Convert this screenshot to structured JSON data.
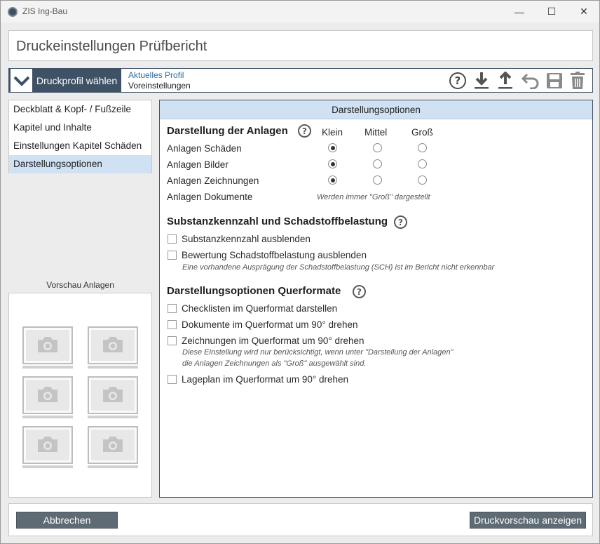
{
  "window": {
    "title": "ZIS Ing-Bau",
    "controls": {
      "minimize": "—",
      "maximize": "☐",
      "close": "✕"
    }
  },
  "header": {
    "title": "Druckeinstellungen Prüfbericht"
  },
  "profile": {
    "button_label": "Druckprofil wählen",
    "caption": "Aktuelles Profil",
    "value": "Voreinstellungen"
  },
  "toolbar": {
    "icons": [
      "help-icon",
      "download-icon",
      "upload-icon",
      "undo-icon",
      "save-icon",
      "delete-icon"
    ],
    "help_glyph": "?"
  },
  "nav": {
    "items": [
      {
        "label": "Deckblatt & Kopf- / Fußzeile",
        "active": false
      },
      {
        "label": "Kapitel und Inhalte",
        "active": false
      },
      {
        "label": "Einstellungen Kapitel Schäden",
        "active": false
      },
      {
        "label": "Darstellungsoptionen",
        "active": true
      }
    ]
  },
  "preview": {
    "title": "Vorschau Anlagen",
    "thumbnail_count": 6
  },
  "panel": {
    "title": "Darstellungsoptionen",
    "help_glyph": "?",
    "anlagen": {
      "title": "Darstellung der Anlagen",
      "columns": [
        "Klein",
        "Mittel",
        "Groß"
      ],
      "rows": [
        {
          "label": "Anlagen Schäden",
          "selected": "Klein"
        },
        {
          "label": "Anlagen Bilder",
          "selected": "Klein"
        },
        {
          "label": "Anlagen Zeichnungen",
          "selected": "Klein"
        },
        {
          "label": "Anlagen Dokumente",
          "note": "Werden immer \"Groß\" dargestellt"
        }
      ]
    },
    "substanz": {
      "title": "Substanzkennzahl und Schadstoffbelastung",
      "options": [
        {
          "label": "Substanzkennzahl ausblenden",
          "checked": false
        },
        {
          "label": "Bewertung Schadstoffbelastung ausblenden",
          "checked": false
        }
      ],
      "note": "Eine vorhandene Ausprägung der Schadstoffbelastung (SCH) ist im Bericht nicht erkennbar"
    },
    "querformat": {
      "title": "Darstellungsoptionen Querformate",
      "options": [
        {
          "label": "Checklisten im Querformat darstellen",
          "checked": false
        },
        {
          "label": "Dokumente im Querformat um 90° drehen",
          "checked": false
        },
        {
          "label": "Zeichnungen im Querformat um 90° drehen",
          "checked": false
        },
        {
          "label": "Lageplan im Querformat um 90° drehen",
          "checked": false
        }
      ],
      "note_line1": "Diese Einstellung wird nur berücksichtigt, wenn unter \"Darstellung der Anlagen\"",
      "note_line2": "die Anlagen Zeichnungen als \"Groß\" ausgewählt sind."
    }
  },
  "footer": {
    "cancel_label": "Abbrechen",
    "preview_label": "Druckvorschau anzeigen"
  },
  "colors": {
    "accent": "#3e5165",
    "highlight": "#cfe1f2",
    "button": "#5f6b74"
  }
}
